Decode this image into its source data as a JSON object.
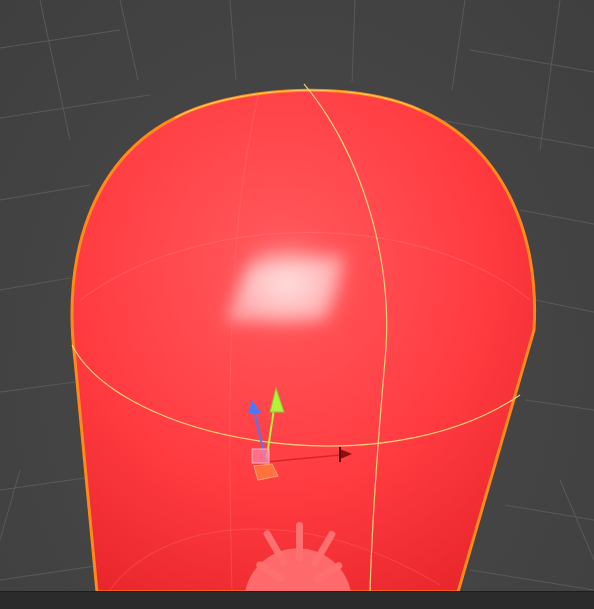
{
  "scene": {
    "object_color": "#ff3b40",
    "highlight_color": "#ffd0d0",
    "outline_color": "#ff8a1a",
    "seam_color": "#ffe080",
    "grid_color": "#5a5a5a",
    "background_color": "#464646"
  },
  "gizmo": {
    "x_axis_color": "#c81e1e",
    "y_axis_color": "#b4f03c",
    "z_axis_color": "#4b78ff",
    "center_handle_color": "#ff7fa0",
    "move_handle_color": "#ff7a3c"
  },
  "icons": {
    "light": "directional-light-icon",
    "light_color": "#ff7070"
  }
}
